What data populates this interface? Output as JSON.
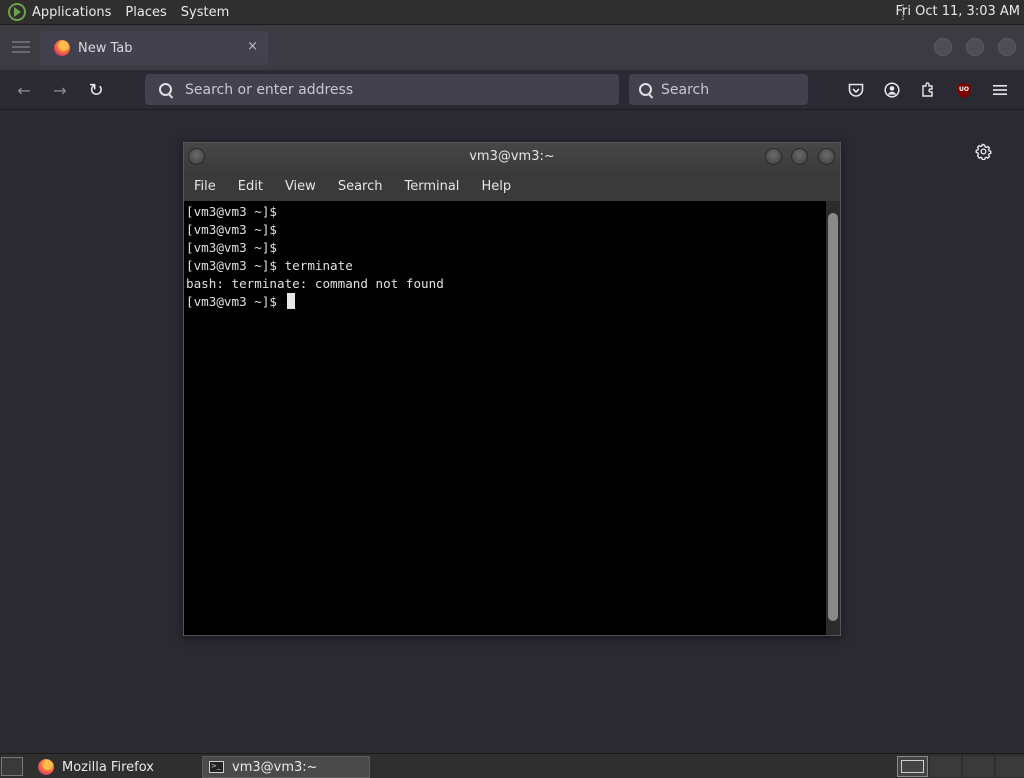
{
  "top_panel": {
    "menus": [
      "Applications",
      "Places",
      "System"
    ],
    "clock": "Fri Oct 11,  3:03 AM"
  },
  "browser": {
    "tab": {
      "title": "New Tab",
      "close_glyph": "×"
    },
    "nav": {
      "back_glyph": "←",
      "forward_glyph": "→",
      "reload_glyph": "↻"
    },
    "urlbar": {
      "placeholder": "Search or enter address"
    },
    "searchbar": {
      "placeholder": "Search"
    },
    "toolbar_icons": [
      "pocket-icon",
      "account-icon",
      "extensions-icon",
      "ublock-origin-icon",
      "menu-icon"
    ],
    "ublock_label": "UO"
  },
  "terminal": {
    "title": "vm3@vm3:~",
    "menu": [
      "File",
      "Edit",
      "View",
      "Search",
      "Terminal",
      "Help"
    ],
    "lines": [
      "[vm3@vm3 ~]$",
      "[vm3@vm3 ~]$",
      "[vm3@vm3 ~]$",
      "[vm3@vm3 ~]$ terminate",
      "bash: terminate: command not found"
    ],
    "prompt": "[vm3@vm3 ~]$ "
  },
  "taskbar": {
    "tasks": [
      {
        "label": "Mozilla Firefox",
        "active": false
      },
      {
        "label": "vm3@vm3:~",
        "active": true
      }
    ]
  },
  "colors": {
    "browser_bg": "#2b2a33",
    "panel_bg": "#2f2f2f",
    "terminal_bg": "#000000",
    "ublock_red": "#800000"
  }
}
